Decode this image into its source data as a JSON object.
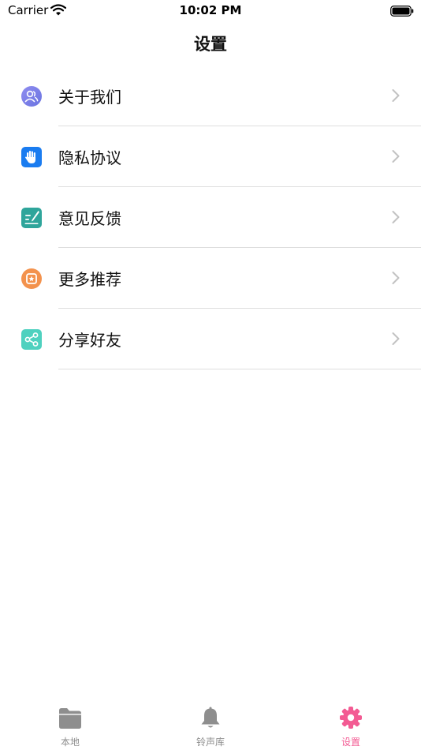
{
  "status_bar": {
    "carrier": "Carrier",
    "time": "10:02 PM"
  },
  "nav": {
    "title": "设置"
  },
  "settings": [
    {
      "label": "关于我们",
      "icon": "about-us-icon",
      "color": "#7b7fe6"
    },
    {
      "label": "隐私协议",
      "icon": "privacy-hand-icon",
      "color": "#1a7cf0"
    },
    {
      "label": "意见反馈",
      "icon": "feedback-icon",
      "color": "#2fa59b"
    },
    {
      "label": "更多推荐",
      "icon": "recommend-star-icon",
      "color": "#f3924d"
    },
    {
      "label": "分享好友",
      "icon": "share-icon",
      "color": "#4fd1bf"
    }
  ],
  "tabs": [
    {
      "label": "本地",
      "icon": "folder-icon",
      "active": false
    },
    {
      "label": "铃声库",
      "icon": "bell-icon",
      "active": false
    },
    {
      "label": "设置",
      "icon": "gear-icon",
      "active": true
    }
  ],
  "colors": {
    "accent": "#f35b93",
    "tab_inactive": "#8e8e8e",
    "divider": "#dedede",
    "chevron": "#c2c2c2"
  }
}
